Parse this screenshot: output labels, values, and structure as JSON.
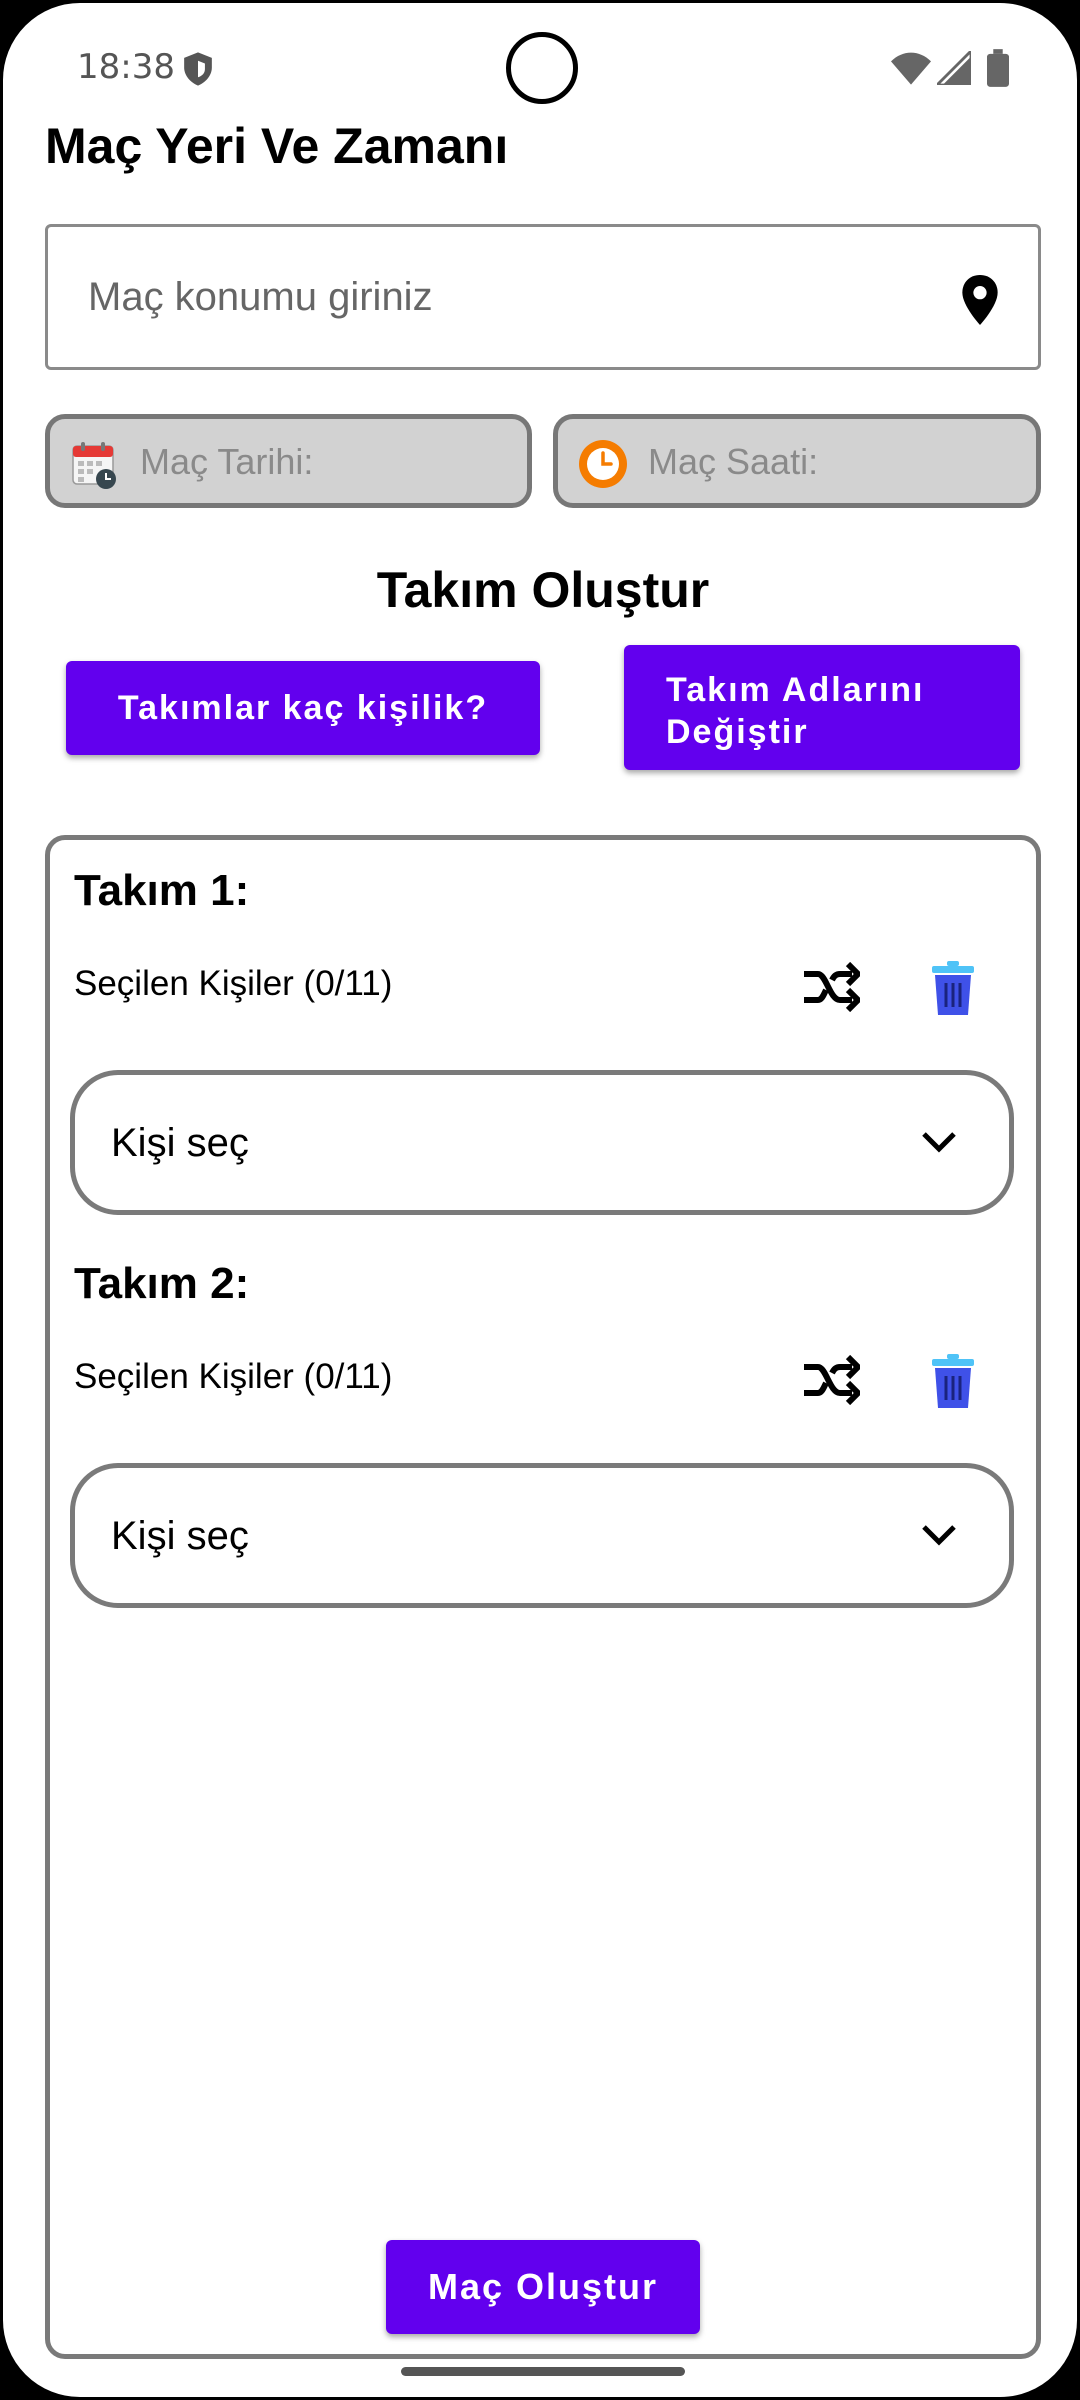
{
  "status_bar": {
    "time": "18:38",
    "icons": [
      "shield-icon",
      "wifi-icon",
      "signal-icon",
      "battery-icon"
    ]
  },
  "page": {
    "title": "Maç Yeri Ve Zamanı"
  },
  "location": {
    "placeholder": "Maç konumu giriniz",
    "icon": "location-pin-icon"
  },
  "date_picker": {
    "label": "Maç Tarihi:",
    "icon": "calendar-icon"
  },
  "time_picker": {
    "label": "Maç Saati:",
    "icon": "clock-icon"
  },
  "team_builder": {
    "title": "Takım Oluştur",
    "team_size_button": "Takımlar kaç kişilik?",
    "rename_button_line1": "Takım Adlarını",
    "rename_button_line2": "Değiştir"
  },
  "teams": [
    {
      "title": "Takım 1:",
      "selected_label": "Seçilen Kişiler (0/11)",
      "select_placeholder": "Kişi seç"
    },
    {
      "title": "Takım 2:",
      "selected_label": "Seçilen Kişiler (0/11)",
      "select_placeholder": "Kişi seç"
    }
  ],
  "footer": {
    "create_button": "Maç Oluştur"
  },
  "colors": {
    "accent": "#6200ee",
    "trash": "#3f51e8",
    "clock": "#f57c00",
    "calendar": "#e53935"
  }
}
